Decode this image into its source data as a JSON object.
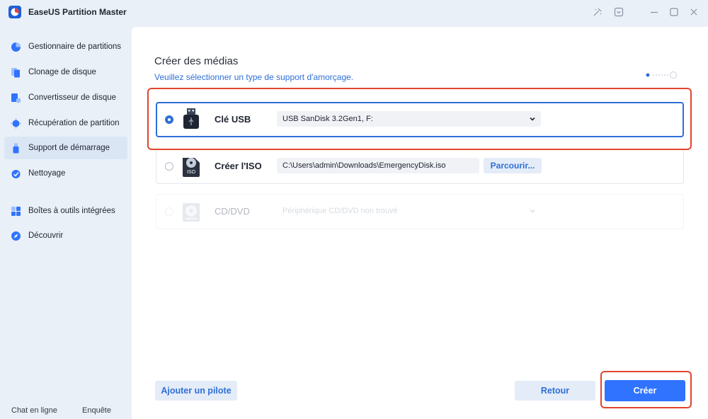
{
  "app": {
    "title": "EaseUS Partition Master",
    "accent": "#2f73ff",
    "highlight_color": "#e0452f"
  },
  "window_controls": [
    "tools-icon",
    "download-icon",
    "minimize-icon",
    "maximize-icon",
    "close-icon"
  ],
  "sidebar": {
    "items": [
      {
        "label": "Gestionnaire de partitions",
        "icon": "pie-chart-icon"
      },
      {
        "label": "Clonage de disque",
        "icon": "clone-icon"
      },
      {
        "label": "Convertisseur de disque",
        "icon": "convert-icon"
      },
      {
        "label": "Récupération de partition",
        "icon": "recovery-icon"
      },
      {
        "label": "Support de démarrage",
        "icon": "usb-icon",
        "active": true
      },
      {
        "label": "Nettoyage",
        "icon": "cleanup-icon"
      },
      {
        "label": "Boîtes à outils intégrées",
        "icon": "toolbox-icon"
      },
      {
        "label": "Découvrir",
        "icon": "compass-icon"
      }
    ],
    "footer": {
      "chat": "Chat en ligne",
      "survey": "Enquête"
    }
  },
  "main": {
    "title": "Créer des médias",
    "subtitle": "Veuillez sélectionner un type de support d'amorçage.",
    "options": [
      {
        "label": "Clé USB",
        "value": "USB SanDisk 3.2Gen1, F:",
        "selected": true,
        "icon": "usb-drive-icon"
      },
      {
        "label": "Créer l'ISO",
        "value": "C:\\Users\\admin\\Downloads\\EmergencyDisk.iso",
        "browse": "Parcourir...",
        "icon": "iso-icon",
        "icon_text": "ISO"
      },
      {
        "label": "CD/DVD",
        "value": "Périphérique CD/DVD non trouvé",
        "disabled": true,
        "icon": "cd-icon"
      }
    ],
    "buttons": {
      "driver": "Ajouter un pilote",
      "back": "Retour",
      "create": "Créer"
    }
  }
}
